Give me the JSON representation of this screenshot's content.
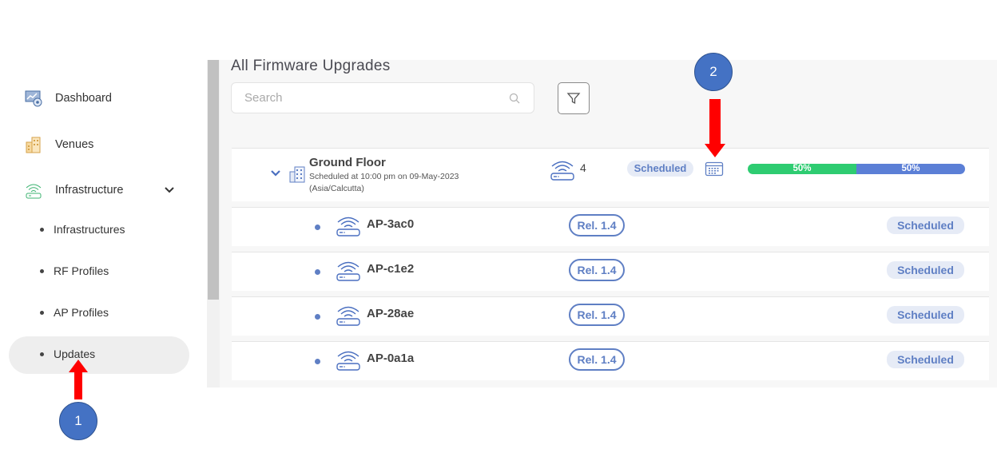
{
  "sidebar": {
    "items": [
      {
        "label": "Dashboard",
        "icon": "dashboard-icon"
      },
      {
        "label": "Venues",
        "icon": "venues-icon"
      },
      {
        "label": "Infrastructure",
        "icon": "infrastructure-icon",
        "expanded": true
      }
    ],
    "sub_items": [
      {
        "label": "Infrastructures"
      },
      {
        "label": "RF Profiles"
      },
      {
        "label": "AP Profiles"
      },
      {
        "label": "Updates",
        "active": true
      }
    ]
  },
  "main": {
    "title": "All Firmware Upgrades",
    "search": {
      "placeholder": "Search",
      "value": ""
    },
    "group": {
      "name": "Ground Floor",
      "schedule_line": "Scheduled at 10:00 pm on 09-May-2023",
      "timezone_line": "(Asia/Calcutta)",
      "ap_count": "4",
      "status": "Scheduled",
      "progress": [
        {
          "label": "50%",
          "value": 50,
          "color": "#2ecc71"
        },
        {
          "label": "50%",
          "value": 50,
          "color": "#5b7fd6"
        }
      ]
    },
    "aps": [
      {
        "name": "AP-3ac0",
        "release": "Rel. 1.4",
        "status": "Scheduled"
      },
      {
        "name": "AP-c1e2",
        "release": "Rel. 1.4",
        "status": "Scheduled"
      },
      {
        "name": "AP-28ae",
        "release": "Rel. 1.4",
        "status": "Scheduled"
      },
      {
        "name": "AP-0a1a",
        "release": "Rel. 1.4",
        "status": "Scheduled"
      }
    ]
  },
  "annotations": {
    "marker_1": "1",
    "marker_2": "2",
    "arrow_color": "#ff0000",
    "marker_color": "#4472c4"
  },
  "colors": {
    "accent": "#5f7fc4",
    "badge_bg": "#e6ebf6"
  }
}
